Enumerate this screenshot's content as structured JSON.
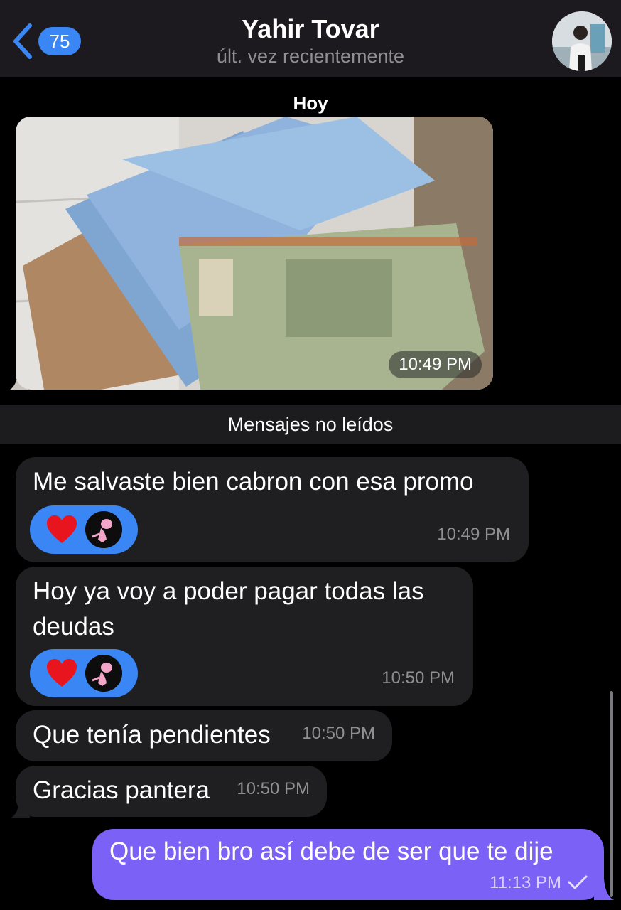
{
  "header": {
    "back_count": "75",
    "title": "Yahir Tovar",
    "subtitle": "últ. vez recientemente",
    "back_icon": "chevron-left-icon",
    "accent": "#3a86f5"
  },
  "chat": {
    "date_label": "Hoy",
    "photo_time": "10:49 PM",
    "unread_label": "Mensajes no leídos",
    "messages": [
      {
        "text": "Me salvaste bien cabron con esa promo",
        "time": "10:49 PM",
        "reaction": "heart"
      },
      {
        "text_line1": "Hoy ya voy a poder pagar todas las",
        "text_line2": "deudas",
        "time": "10:50 PM",
        "reaction": "heart"
      },
      {
        "text": "Que tenía pendientes",
        "time": "10:50 PM"
      },
      {
        "text": "Gracias pantera",
        "time": "10:50 PM"
      }
    ],
    "outgoing": {
      "text": "Que bien bro así debe de ser que te dije",
      "time": "11:13 PM",
      "status": "sent"
    }
  },
  "colors": {
    "incoming_bubble": "#1f1f21",
    "outgoing_bubble": "#7b61f5",
    "reaction_pill": "#3a86f5"
  }
}
